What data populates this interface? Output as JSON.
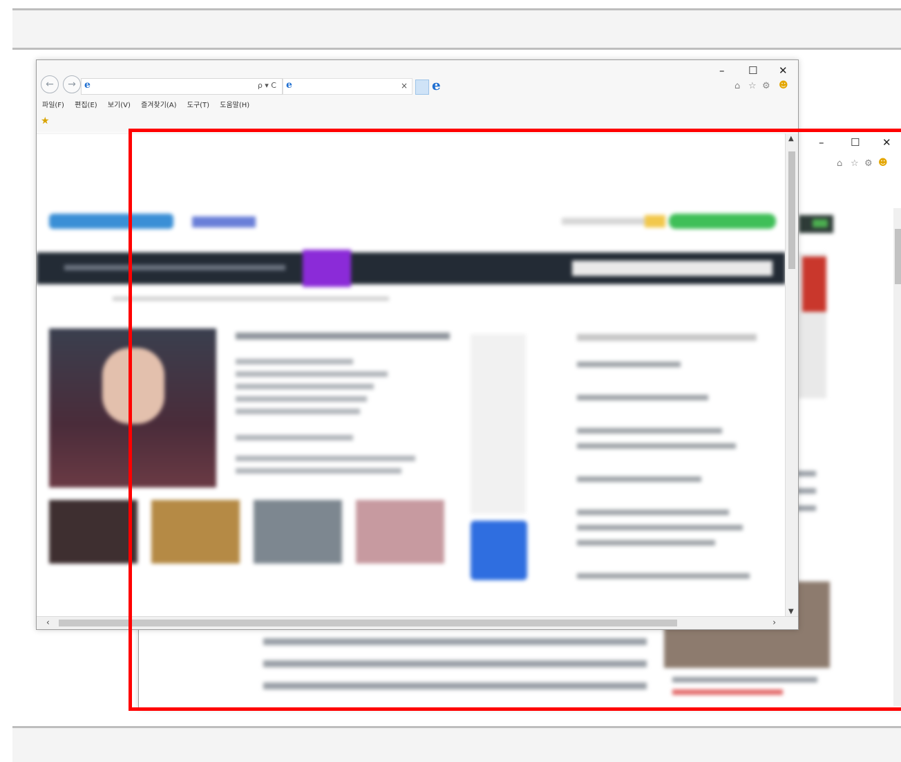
{
  "menu": [
    "파일(F)",
    "편집(E)",
    "보기(V)",
    "즐겨찾기(A)",
    "도구(T)",
    "도움말(H)"
  ],
  "address_controls": "ρ ▾ C",
  "tab_close": "×",
  "window_controls": {
    "minimize": "–",
    "maximize": "☐",
    "close": "✕"
  },
  "toolbar_icons": [
    "home-icon",
    "star-icon",
    "settings-icon",
    "smiley-icon"
  ],
  "highlight_color": "#ff0000"
}
